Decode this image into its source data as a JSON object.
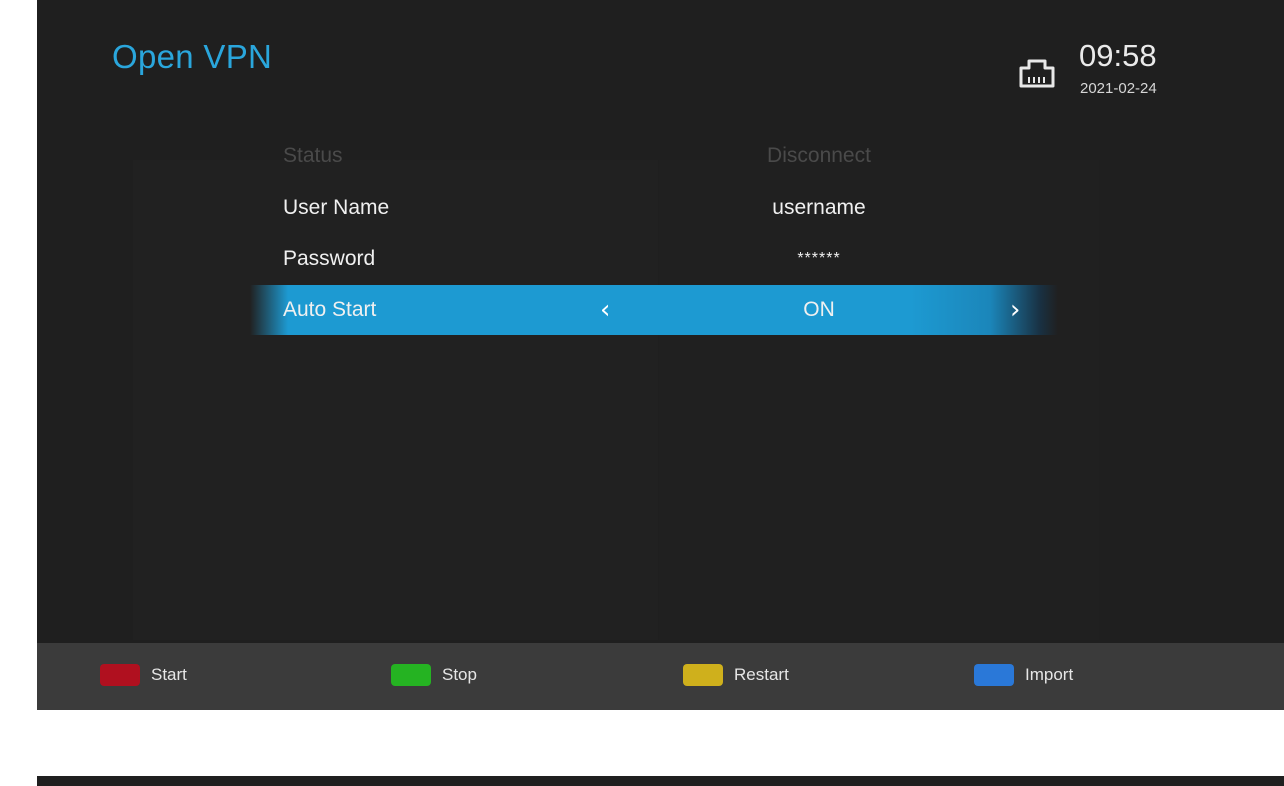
{
  "header": {
    "title": "Open VPN",
    "time": "09:58",
    "date": "2021-02-24",
    "network_icon": "ethernet-port-icon"
  },
  "settings": [
    {
      "label": "Status",
      "value": "Disconnect",
      "enabled": false
    },
    {
      "label": "User Name",
      "value": "username",
      "enabled": true
    },
    {
      "label": "Password",
      "value": "******",
      "enabled": true
    },
    {
      "label": "Auto Start",
      "value": "ON",
      "enabled": true,
      "selected": true
    }
  ],
  "selector": {
    "left_arrow": "‹",
    "right_arrow": "›"
  },
  "footer": {
    "keys": [
      {
        "label": "Start",
        "color": "#b0101f"
      },
      {
        "label": "Stop",
        "color": "#25b322"
      },
      {
        "label": "Restart",
        "color": "#cfb01c"
      },
      {
        "label": "Import",
        "color": "#2a78d8"
      }
    ]
  },
  "colors": {
    "accent": "#2aa6dc",
    "selection": "#1d9ad2",
    "background": "#1f1f1f"
  }
}
